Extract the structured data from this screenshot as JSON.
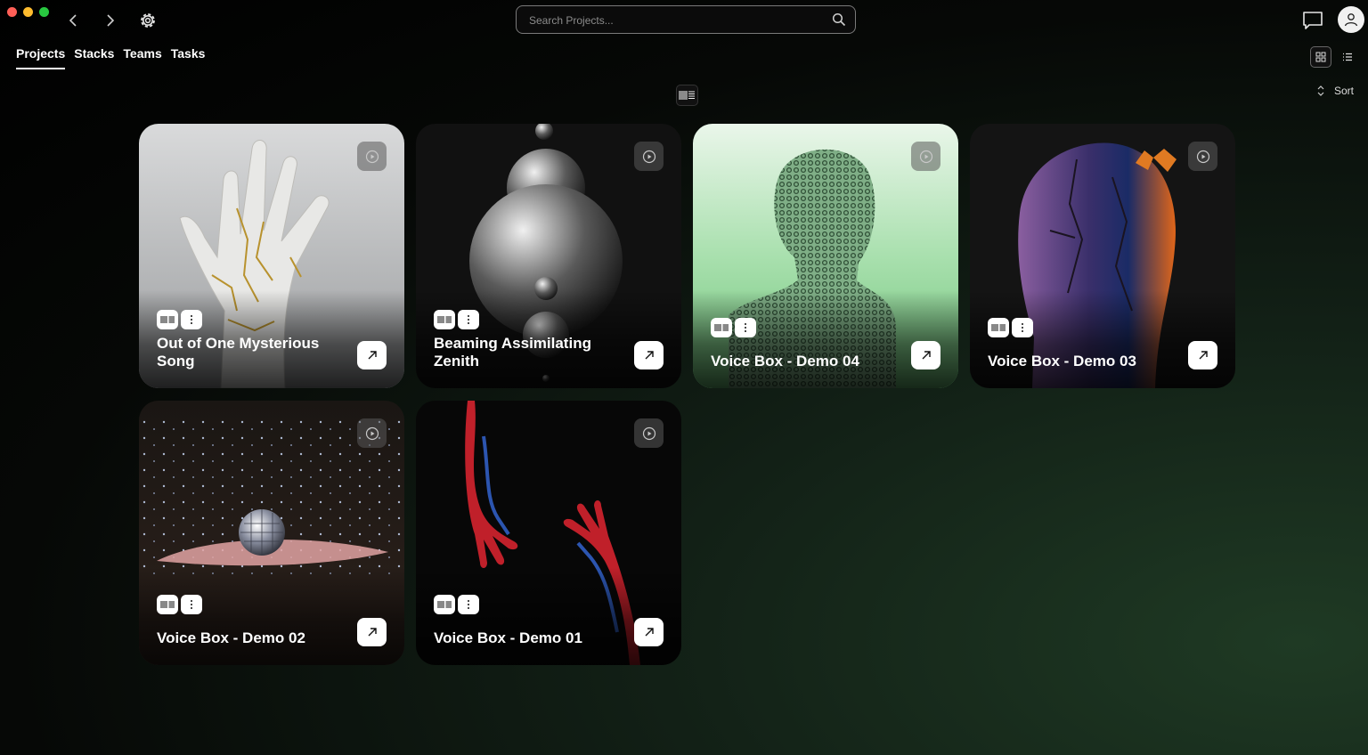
{
  "search": {
    "placeholder": "Search Projects..."
  },
  "tabs": [
    {
      "label": "Projects",
      "active": true
    },
    {
      "label": "Stacks",
      "active": false
    },
    {
      "label": "Teams",
      "active": false
    },
    {
      "label": "Tasks",
      "active": false
    }
  ],
  "toolbar": {
    "sort_label": "Sort",
    "view_mode": "grid"
  },
  "icons": {
    "back": "chevron-left-icon",
    "forward": "chevron-right-icon",
    "settings": "gear-icon",
    "search": "search-icon",
    "messages": "chat-icon",
    "account": "user-icon",
    "grid": "grid-view-icon",
    "list": "list-view-icon",
    "sort": "sort-icon",
    "card_play": "play-icon",
    "card_tag": "waveform-tag-icon",
    "card_menu": "more-vertical-icon",
    "card_open": "arrow-up-right-icon"
  },
  "colors": {
    "accent_green": "#1f3a24",
    "card_button": "#ffffff"
  },
  "projects": [
    {
      "title": "Out of One Mysterious Song",
      "art": "cracked-marble-hand"
    },
    {
      "title": "Beaming Assimilating Zenith",
      "art": "stacked-spheres"
    },
    {
      "title": "Voice Box - Demo 04",
      "art": "mesh-head-green"
    },
    {
      "title": "Voice Box - Demo 03",
      "art": "cracked-head-butterfly"
    },
    {
      "title": "Voice Box - Demo 02",
      "art": "disco-ball"
    },
    {
      "title": "Voice Box - Demo 01",
      "art": "red-blue-hands"
    }
  ]
}
